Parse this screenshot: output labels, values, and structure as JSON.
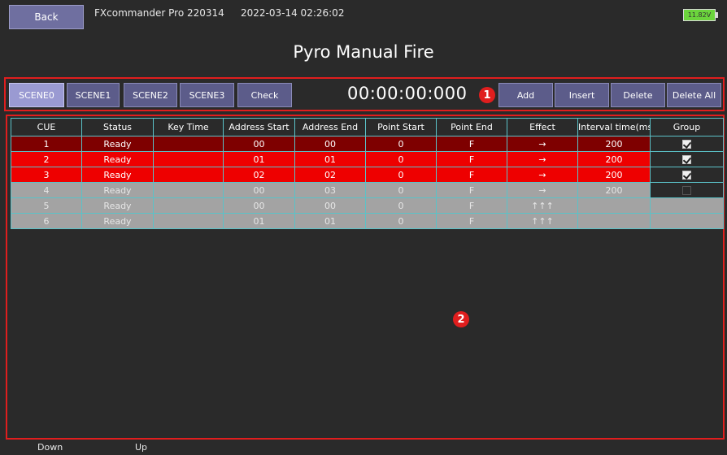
{
  "header": {
    "back_label": "Back",
    "app_name": "FXcommander Pro 220314",
    "datetime": "2022-03-14 02:26:02",
    "battery": "11.82V"
  },
  "page_title": "Pyro Manual Fire",
  "toolbar": {
    "scenes": [
      "SCENE0",
      "SCENE1",
      "SCENE2",
      "SCENE3"
    ],
    "active_scene": "SCENE0",
    "check_label": "Check",
    "timer": "00:00:00:000",
    "add_label": "Add",
    "insert_label": "Insert",
    "delete_label": "Delete",
    "delete_all_label": "Delete All"
  },
  "markers": [
    "1",
    "2"
  ],
  "table": {
    "columns": [
      "CUE",
      "Status",
      "Key Time",
      "Address Start",
      "Address End",
      "Point Start",
      "Point End",
      "Effect",
      "Interval time(ms)",
      "Group"
    ],
    "rows": [
      {
        "cue": "1",
        "status": "Ready",
        "key_time": "",
        "address_start": "00",
        "address_end": "00",
        "point_start": "0",
        "point_end": "F",
        "effect": "→",
        "interval": "200",
        "group": "checked"
      },
      {
        "cue": "2",
        "status": "Ready",
        "key_time": "",
        "address_start": "01",
        "address_end": "01",
        "point_start": "0",
        "point_end": "F",
        "effect": "→",
        "interval": "200",
        "group": "checked"
      },
      {
        "cue": "3",
        "status": "Ready",
        "key_time": "",
        "address_start": "02",
        "address_end": "02",
        "point_start": "0",
        "point_end": "F",
        "effect": "→",
        "interval": "200",
        "group": "checked"
      },
      {
        "cue": "4",
        "status": "Ready",
        "key_time": "",
        "address_start": "00",
        "address_end": "03",
        "point_start": "0",
        "point_end": "F",
        "effect": "→",
        "interval": "200",
        "group": "unchecked"
      },
      {
        "cue": "5",
        "status": "Ready",
        "key_time": "",
        "address_start": "00",
        "address_end": "00",
        "point_start": "0",
        "point_end": "F",
        "effect": "↑↑↑",
        "interval": "",
        "group": ""
      },
      {
        "cue": "6",
        "status": "Ready",
        "key_time": "",
        "address_start": "01",
        "address_end": "01",
        "point_start": "0",
        "point_end": "F",
        "effect": "↑↑↑",
        "interval": "",
        "group": ""
      }
    ]
  },
  "footer": {
    "down_label": "Down",
    "up_label": "Up"
  },
  "colors": {
    "background": "#2a2a2a",
    "button": "#5c5c8a",
    "button_active": "#9a9ad2",
    "highlight_border": "#e01e1e",
    "row_selected": "#7e0000",
    "row_red": "#ee0000",
    "row_gray": "#a3a3a3",
    "grid_line": "#5bc2c8",
    "battery": "#6bd43c"
  }
}
